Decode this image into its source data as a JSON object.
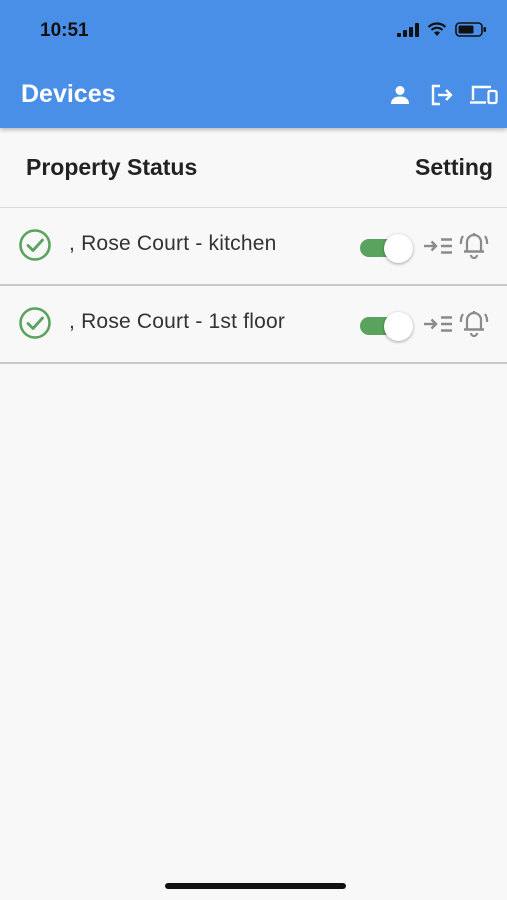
{
  "status_bar": {
    "time": "10:51"
  },
  "appbar": {
    "title": "Devices",
    "actions": [
      {
        "icon": "person-icon"
      },
      {
        "icon": "logout-icon"
      },
      {
        "icon": "devices-icon"
      }
    ]
  },
  "table": {
    "header": {
      "left": "Property Status",
      "right": "Setting"
    },
    "rows": [
      {
        "status_icon": "check-circle-icon",
        "name": ", Rose Court - kitchen",
        "toggle_on": true
      },
      {
        "status_icon": "check-circle-icon",
        "name": ", Rose Court - 1st floor",
        "toggle_on": true
      }
    ]
  },
  "colors": {
    "appbar": "#4a8fe7",
    "status_ok": "#5aa35e",
    "toggle_on": "#5aa35e",
    "background": "#f8f8f8"
  }
}
